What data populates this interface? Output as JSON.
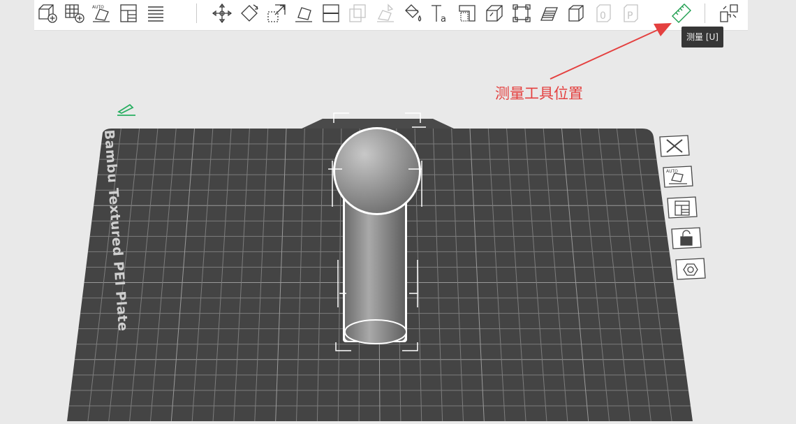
{
  "toolbar": {
    "icons": [
      "add-cube-icon",
      "add-grid-icon",
      "auto-orient-icon",
      "arrange-icon",
      "layers-icon",
      "move-icon",
      "rotate-icon",
      "scale-icon",
      "lay-on-face-icon",
      "split-icon",
      "cut-icon",
      "support-paint-icon",
      "color-paint-icon",
      "text-icon",
      "emboss-icon",
      "assembly-icon",
      "variable-layer-height-icon",
      "boolean-icon",
      "seam-paint-icon",
      "object-paint-icon",
      "plate-paint-icon",
      "measure-icon",
      "explode-icon"
    ],
    "tooltip": "测量 [U]",
    "tooltip_for": "measure-icon"
  },
  "annotation": {
    "text": "测量工具位置",
    "color": "#e4403f"
  },
  "plate": {
    "label": "Bambu Textured PEI Plate",
    "color": "#444444"
  },
  "side_controls": [
    {
      "name": "close-plate-icon"
    },
    {
      "name": "auto-arrange-plate-icon"
    },
    {
      "name": "plate-layout-icon"
    },
    {
      "name": "unlock-icon"
    },
    {
      "name": "plate-settings-icon"
    }
  ],
  "colors": {
    "accent_green": "#27ae60",
    "canvas_bg": "#e9e9e9"
  }
}
